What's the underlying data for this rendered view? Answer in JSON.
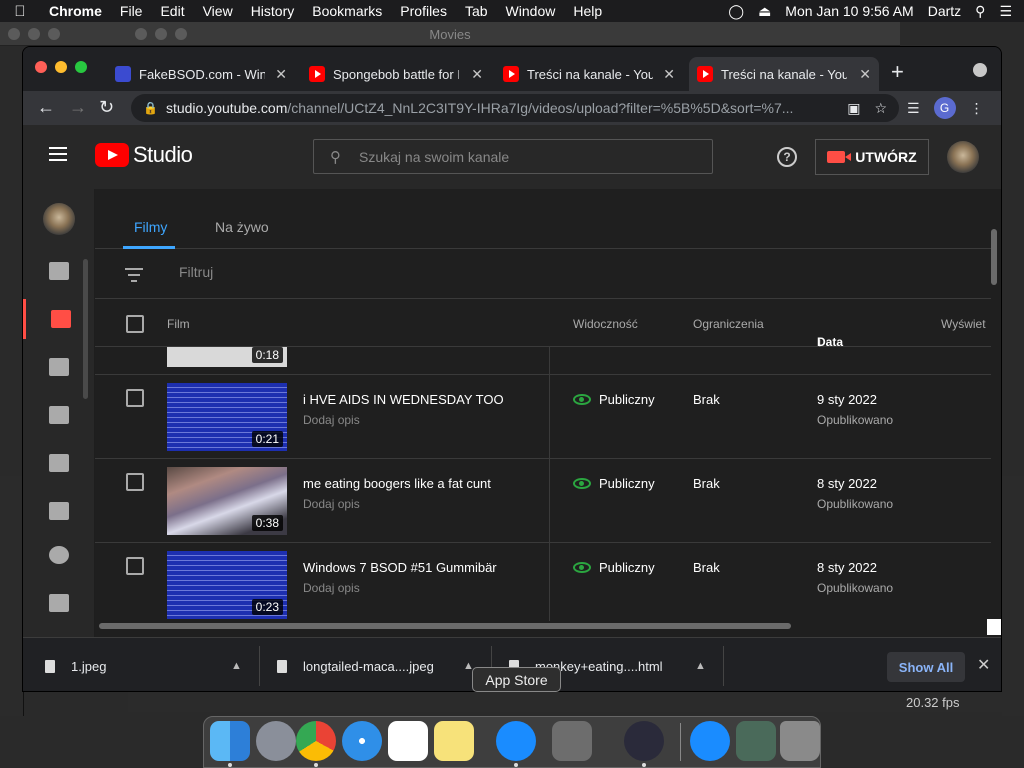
{
  "menubar": {
    "app": "Chrome",
    "items": [
      "File",
      "Edit",
      "View",
      "History",
      "Bookmarks",
      "Profiles",
      "Tab",
      "Window",
      "Help"
    ],
    "clock": "Mon Jan 10  9:56 AM",
    "user": "Dartz"
  },
  "bg_window": {
    "title": "Movies"
  },
  "tabs": [
    {
      "title": "FakeBSOD.com - Windows",
      "favicon": "monitor-icon"
    },
    {
      "title": "Spongebob battle for Bikini",
      "favicon": "youtube-icon"
    },
    {
      "title": "Treści na kanale - YouTube",
      "favicon": "youtube-icon"
    },
    {
      "title": "Treści na kanale - YouTube",
      "favicon": "youtube-icon"
    }
  ],
  "address": {
    "host": "studio.youtube.com",
    "path": "/channel/UCtZ4_NnL2C3IT9Y-IHRa7Ig/videos/upload?filter=%5B%5D&sort=%7..."
  },
  "profile_letter": "G",
  "studio": {
    "logo_text": "Studio",
    "search_placeholder": "Szukaj na swoim kanale",
    "create_label": "UTWÓRZ"
  },
  "content_tabs": [
    "Filmy",
    "Na żywo"
  ],
  "filter_placeholder": "Filtruj",
  "columns": {
    "film": "Film",
    "visibility": "Widoczność",
    "restrictions": "Ograniczenia",
    "date": "Data",
    "views": "Wyświet"
  },
  "videos": [
    {
      "title": "",
      "desc": "",
      "duration": "0:18",
      "visibility": "",
      "restrictions": "",
      "date": "",
      "status": ""
    },
    {
      "title": "i HVE AIDS IN WEDNESDAY TOO",
      "desc": "Dodaj opis",
      "duration": "0:21",
      "visibility": "Publiczny",
      "restrictions": "Brak",
      "date": "9 sty 2022",
      "status": "Opublikowano"
    },
    {
      "title": "me eating boogers like a fat cunt",
      "desc": "Dodaj opis",
      "duration": "0:38",
      "visibility": "Publiczny",
      "restrictions": "Brak",
      "date": "8 sty 2022",
      "status": "Opublikowano"
    },
    {
      "title": "Windows 7 BSOD #51 Gummibär",
      "desc": "Dodaj opis",
      "duration": "0:23",
      "visibility": "Publiczny",
      "restrictions": "Brak",
      "date": "8 sty 2022",
      "status": "Opublikowano"
    }
  ],
  "downloads": {
    "items": [
      "1.jpeg",
      "longtailed-maca....jpeg",
      "monkey+eating....html"
    ],
    "show_all": "Show All"
  },
  "tooltip": "App Store",
  "fps": "20.32 fps",
  "colors": {
    "accent": "#3ea6ff",
    "youtube_red": "#ff0000",
    "public_green": "#2ba640"
  }
}
